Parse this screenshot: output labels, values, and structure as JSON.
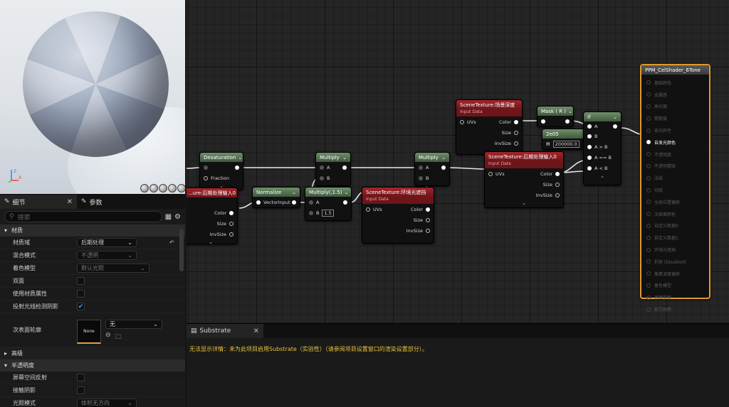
{
  "viewport": {
    "axis_labels": [
      "Z",
      "X"
    ]
  },
  "details": {
    "tabs": [
      {
        "label": "细节",
        "icon": "pencil-icon"
      },
      {
        "label": "参数",
        "icon": "pencil-icon"
      }
    ],
    "search_placeholder": "搜索",
    "sections": {
      "material": {
        "title": "材质",
        "rows": {
          "domain": {
            "label": "材质域",
            "value": "后期处理"
          },
          "blend": {
            "label": "混合模式",
            "value": "不透明"
          },
          "shading": {
            "label": "着色模型",
            "value": "默认光照"
          },
          "twosided": {
            "label": "双面"
          },
          "attrs": {
            "label": "使用材质属性"
          },
          "raytrace": {
            "label": "投射光线检测阴影"
          },
          "subsurface": {
            "label": "次表面轮廓",
            "thumb": "None",
            "value": "无"
          }
        }
      },
      "advanced": {
        "title": "高级"
      },
      "translucency": {
        "title": "半透明度",
        "rows": {
          "ssr": {
            "label": "屏幕空间反射"
          },
          "contact": {
            "label": "接触阴影"
          },
          "lighting": {
            "label": "光照模式",
            "value": "体积无方向"
          }
        }
      }
    }
  },
  "graph": {
    "desat": {
      "title": "Desaturation",
      "pin": "Fraction"
    },
    "pp0_left": {
      "title": "...ure:后期处理输入0",
      "pins": [
        "Color",
        "Size",
        "InvSize"
      ]
    },
    "normalize": {
      "title": "Normalize",
      "pin": "VectorInput"
    },
    "mult1": {
      "title": "Multiply",
      "pins": [
        "A",
        "B"
      ]
    },
    "mult15": {
      "title": "Multiply(,1.5)",
      "pins": [
        "A",
        "B"
      ],
      "b_value": "1.5"
    },
    "sceneenv": {
      "title": "SceneTexture:环境光遮挡",
      "sub": "Input Data",
      "pins": [
        "UVs",
        "Color",
        "Size",
        "InvSize"
      ]
    },
    "mult2": {
      "title": "Multiply",
      "pins": [
        "A",
        "B"
      ]
    },
    "scenedepth": {
      "title": "SceneTexture:场景深度",
      "sub": "Input Data",
      "pins": [
        "UVs",
        "Color",
        "Size",
        "InvSize"
      ]
    },
    "pp0": {
      "title": "SceneTexture:后期处理输入0",
      "sub": "Input Data",
      "pins": [
        "UVs",
        "Color",
        "Size",
        "InvSize"
      ]
    },
    "mask": {
      "title": "Mask ( R )"
    },
    "const": {
      "title": "2e05",
      "value": "200000.0"
    },
    "if": {
      "title": "If",
      "pins": [
        "A",
        "B",
        "A > B",
        "A == B",
        "A < B"
      ]
    },
    "result": {
      "title": "PPM_CelShader_6Tone",
      "pins": [
        "基础颜色",
        "金属感",
        "高光度",
        "粗糙度",
        "各向异性",
        "自发光颜色",
        "不透明度",
        "不透明蒙版",
        "法线",
        "切线",
        "全局位置偏移",
        "次表面颜色",
        "自定义数据0",
        "自定义数据1",
        "环境光遮挡",
        "折射 (Disabled)",
        "像素深度偏移",
        "着色模型",
        "表面厚度",
        "前方材质"
      ]
    }
  },
  "substrate": {
    "tab": "Substrate",
    "message": "无法显示详情：未为此项目启用Substrate（实验性）（请参阅项目设置窗口的渲染设置部分）。"
  }
}
